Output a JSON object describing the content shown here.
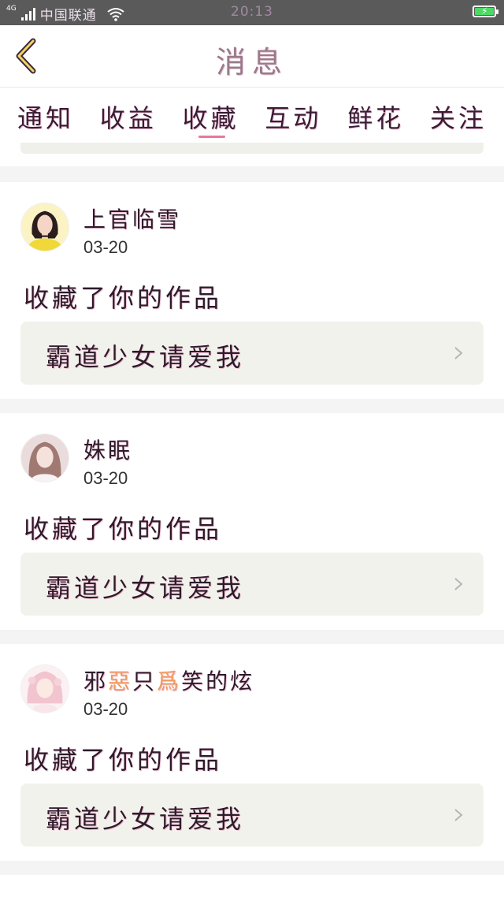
{
  "status_bar": {
    "network": "4G",
    "carrier": "中国联通",
    "time": "20:13"
  },
  "header": {
    "title": "消息"
  },
  "tabs": [
    {
      "label": "通知"
    },
    {
      "label": "收益"
    },
    {
      "label": "收藏",
      "active": true
    },
    {
      "label": "互动"
    },
    {
      "label": "鲜花"
    },
    {
      "label": "关注"
    }
  ],
  "messages": [
    {
      "username": "上官临雪",
      "date": "03-20",
      "action": "收藏了你的作品",
      "work_title": "霸道少女请爱我"
    },
    {
      "username": "姝眠",
      "date": "03-20",
      "action": "收藏了你的作品",
      "work_title": "霸道少女请爱我"
    },
    {
      "username_parts": [
        "邪",
        "惡",
        "只",
        "爲",
        "笑的炫"
      ],
      "date": "03-20",
      "action": "收藏了你的作品",
      "work_title": "霸道少女请爱我"
    }
  ],
  "colors": {
    "tab_underline": "#e8789a",
    "username_accent": "#f09a60",
    "card_background": "#ffffff",
    "work_box_background": "#f2f2ec"
  }
}
